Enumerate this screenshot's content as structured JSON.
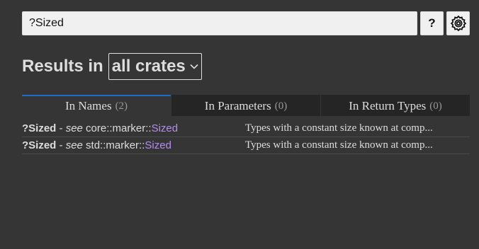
{
  "search": {
    "value": "?Sized",
    "help_label": "?",
    "settings_icon": "gear-icon"
  },
  "heading": {
    "prefix": "Results in",
    "crate_filter": "all crates",
    "chevron_icon": "chevron-down-icon"
  },
  "tabs": [
    {
      "label": "In Names",
      "count": "(2)",
      "active": true
    },
    {
      "label": "In Parameters",
      "count": "(0)",
      "active": false
    },
    {
      "label": "In Return Types",
      "count": "(0)",
      "active": false
    }
  ],
  "results": [
    {
      "name": "?Sized",
      "sep": " - ",
      "see": "see",
      "path": " core::marker::",
      "trait": "Sized",
      "description": "Types with a constant size known at comp..."
    },
    {
      "name": "?Sized",
      "sep": " - ",
      "see": "see",
      "path": " std::marker::",
      "trait": "Sized",
      "description": "Types with a constant size known at comp..."
    }
  ],
  "colors": {
    "background": "#353535",
    "tab_inactive": "#252525",
    "tab_active_border": "#1f6cc8",
    "trait_link": "#b78cf2"
  }
}
